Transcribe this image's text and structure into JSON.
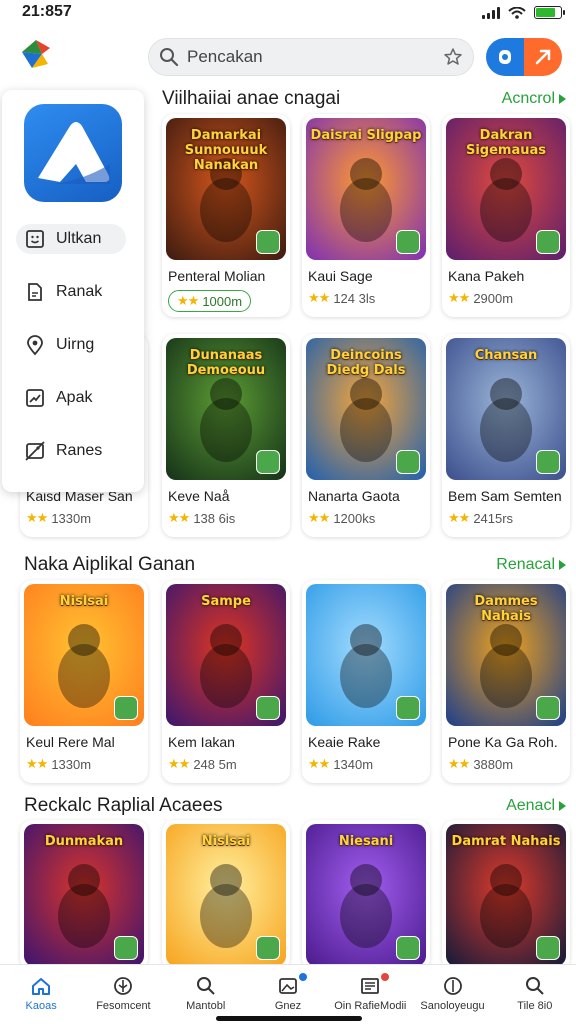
{
  "status_bar": {
    "time": "21:857"
  },
  "header": {
    "search_placeholder": "Pencakan",
    "icons": [
      "app-logo",
      "search-icon",
      "star-icon",
      "toggle-left-icon",
      "toggle-right-icon"
    ]
  },
  "colors": {
    "accent_green": "#27a23b",
    "accent_blue": "#1f7ae0",
    "accent_orange": "#ff6b2c",
    "star": "#f4b400"
  },
  "drawer": {
    "items": [
      {
        "label": "Ultkan",
        "icon": "smile-box-icon"
      },
      {
        "label": "Ranak",
        "icon": "document-icon"
      },
      {
        "label": "Uirng",
        "icon": "location-pin-icon"
      },
      {
        "label": "Apak",
        "icon": "chart-box-icon"
      },
      {
        "label": "Ranes",
        "icon": "no-image-icon"
      }
    ]
  },
  "sections": [
    {
      "title": "Viilhaiiai anae cnagai",
      "link": "Acncrol",
      "cards": [
        {
          "name": "Penteral Molian",
          "meta": "1000m",
          "art": "Damarkai Sunnouuuk Nanakan",
          "palette": [
            "#3a1a10",
            "#d4561c"
          ]
        },
        {
          "name": "Kaui Sage",
          "meta": "124 3ls",
          "art": "Daisrai Sligpap",
          "palette": [
            "#7d2fb5",
            "#ff9a2f"
          ]
        },
        {
          "name": "Kana Pakeh",
          "meta": "2900m",
          "art": "Dakran Sigemauas",
          "palette": [
            "#5a1d6e",
            "#e04a3c"
          ]
        },
        {
          "name": "Kaisd Maser San",
          "meta": "1330m",
          "art": "",
          "palette": [
            "#3a2a1a",
            "#b06a2a"
          ]
        },
        {
          "name": "Keve Naå",
          "meta": "138 6is",
          "art": "Dunanaas Demoeouu",
          "palette": [
            "#143018",
            "#5c9c34"
          ]
        },
        {
          "name": "Nanarta Gaota",
          "meta": "1200ks",
          "art": "Deincoins Diedg Dals",
          "palette": [
            "#1d5fb0",
            "#f6a53a"
          ]
        },
        {
          "name": "Bem Sam Semten",
          "meta": "2415rs",
          "art": "Chansan",
          "palette": [
            "#3b4d8c",
            "#9ab6d8"
          ]
        }
      ]
    },
    {
      "title": "Naka Aiplikal Ganan",
      "link": "Renacal",
      "cards": [
        {
          "name": "Keul Rere Mal",
          "meta": "1330m",
          "art": "Nislsai",
          "palette": [
            "#ff7d1e",
            "#ffc332"
          ]
        },
        {
          "name": "Kem Iakan",
          "meta": "248 5m",
          "art": "Sampe",
          "palette": [
            "#3a1670",
            "#e0351f"
          ]
        },
        {
          "name": "Keaie Rake",
          "meta": "1340m",
          "art": "",
          "palette": [
            "#2d9ae6",
            "#a3dcff"
          ]
        },
        {
          "name": "Pone Ka Ga Roh.",
          "meta": "3880m",
          "art": "Dammes Nahais",
          "palette": [
            "#1a3d8c",
            "#f0a21c"
          ]
        }
      ]
    },
    {
      "title": "Reckalc Raplial Acaees",
      "link": "Aenacl",
      "cards": [
        {
          "name": "",
          "meta": "",
          "art": "Dunmakan",
          "palette": [
            "#3a1470",
            "#d9342b"
          ]
        },
        {
          "name": "",
          "meta": "",
          "art": "Nislsai",
          "palette": [
            "#f7a21c",
            "#fff1a0"
          ]
        },
        {
          "name": "",
          "meta": "",
          "art": "Niesani",
          "palette": [
            "#4a1a8c",
            "#a25ef0"
          ]
        },
        {
          "name": "",
          "meta": "",
          "art": "Damrat Nahais",
          "palette": [
            "#111a3a",
            "#e03a2a"
          ]
        }
      ]
    }
  ],
  "bottom_nav": [
    {
      "label": "Kaoas",
      "icon": "home-icon",
      "active": true
    },
    {
      "label": "Fesomcent",
      "icon": "leaf-icon",
      "active": false
    },
    {
      "label": "Mantobl",
      "icon": "search-icon",
      "active": false
    },
    {
      "label": "Gnez",
      "icon": "image-icon",
      "active": false,
      "dot": "blue"
    },
    {
      "label": "Oin RafieModii",
      "icon": "news-icon",
      "active": false,
      "dot": "red"
    },
    {
      "label": "Sanoloyeugu",
      "icon": "shield-icon",
      "active": false
    },
    {
      "label": "Tile 8i0",
      "icon": "search-icon",
      "active": false
    }
  ]
}
